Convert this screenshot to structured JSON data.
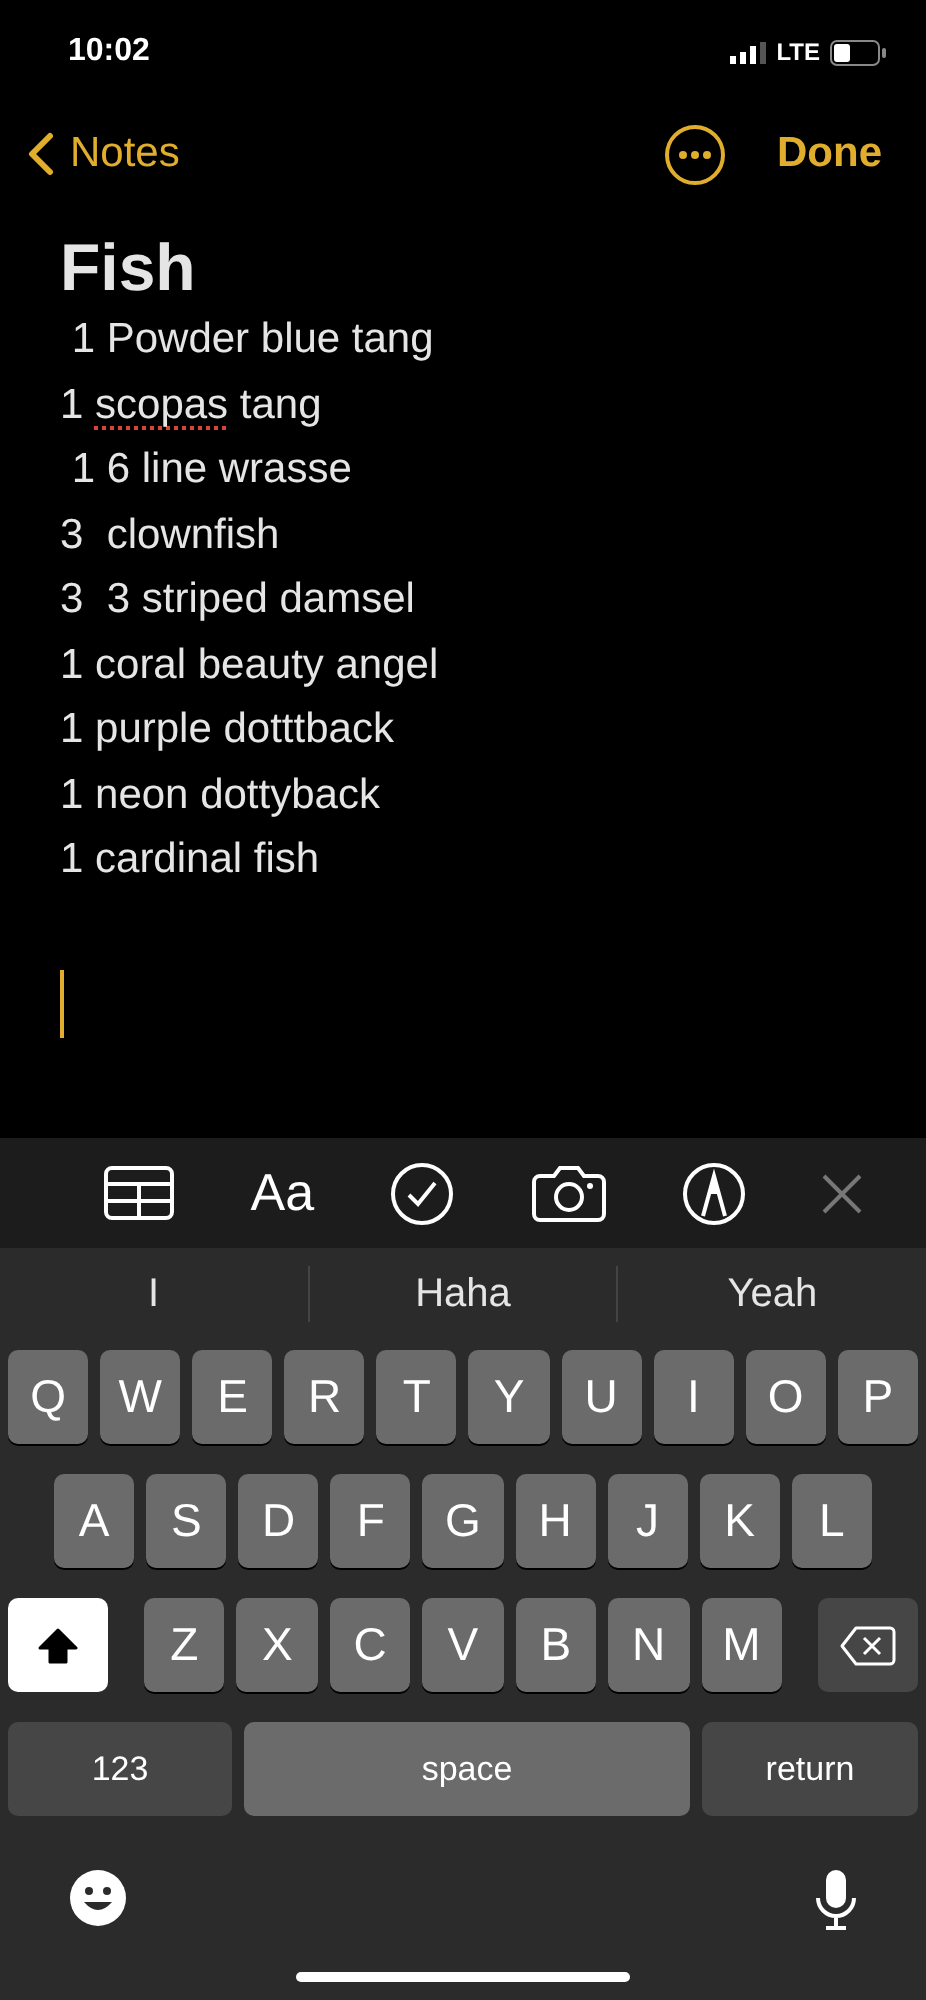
{
  "status_bar": {
    "time": "10:02",
    "network": "LTE"
  },
  "nav": {
    "back_label": "Notes",
    "done_label": "Done"
  },
  "note": {
    "title": "Fish",
    "lines": [
      [
        {
          "text": " 1 Powder blue tang",
          "misspelled": false
        }
      ],
      [
        {
          "text": "1 ",
          "misspelled": false
        },
        {
          "text": "scopas",
          "misspelled": true
        },
        {
          "text": " tang",
          "misspelled": false
        }
      ],
      [
        {
          "text": " 1 6 line wrasse",
          "misspelled": false
        }
      ],
      [
        {
          "text": "3  clownfish",
          "misspelled": false
        }
      ],
      [
        {
          "text": "3  3 striped damsel",
          "misspelled": false
        }
      ],
      [
        {
          "text": "1 coral beauty angel",
          "misspelled": false
        }
      ],
      [
        {
          "text": "1 purple dotttback",
          "misspelled": false
        }
      ],
      [
        {
          "text": "1 neon dottyback",
          "misspelled": false
        }
      ],
      [
        {
          "text": "1 cardinal fish",
          "misspelled": false
        }
      ]
    ]
  },
  "toolbar": {
    "format_label": "Aa"
  },
  "suggestions": [
    "I",
    "Haha",
    "Yeah"
  ],
  "keyboard": {
    "rows": [
      [
        "Q",
        "W",
        "E",
        "R",
        "T",
        "Y",
        "U",
        "I",
        "O",
        "P"
      ],
      [
        "A",
        "S",
        "D",
        "F",
        "G",
        "H",
        "J",
        "K",
        "L"
      ],
      [
        "Z",
        "X",
        "C",
        "V",
        "B",
        "N",
        "M"
      ]
    ],
    "shift_on": true,
    "numbers_label": "123",
    "space_label": "space",
    "return_label": "return"
  }
}
